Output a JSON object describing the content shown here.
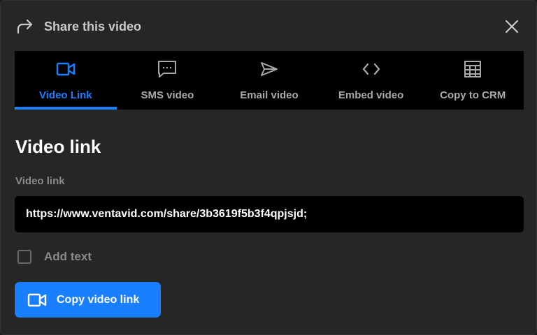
{
  "header": {
    "title": "Share this video",
    "share_icon": "share-arrow-icon",
    "close_icon": "close-icon"
  },
  "tabs": [
    {
      "label": "Video Link",
      "icon": "video-camera-icon",
      "active": true
    },
    {
      "label": "SMS video",
      "icon": "chat-bubble-icon",
      "active": false
    },
    {
      "label": "Email video",
      "icon": "send-icon",
      "active": false
    },
    {
      "label": "Embed video",
      "icon": "code-icon",
      "active": false
    },
    {
      "label": "Copy to CRM",
      "icon": "table-grid-icon",
      "active": false
    }
  ],
  "main": {
    "section_title": "Video link",
    "field_label": "Video link",
    "link_value": "https://www.ventavid.com/share/3b3619f5b3f4qpjsjd;",
    "checkbox_label": "Add text",
    "checkbox_checked": false,
    "copy_button_label": "Copy video link"
  },
  "colors": {
    "accent": "#1a7fff",
    "background": "#262626",
    "tab_bar": "#000000"
  }
}
